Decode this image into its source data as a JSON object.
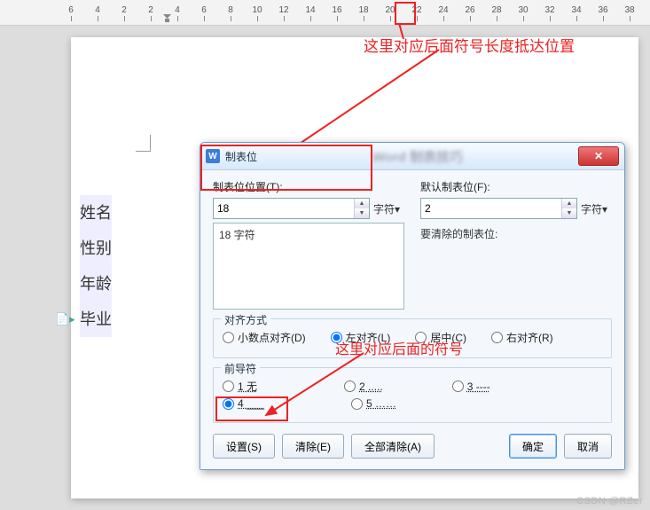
{
  "ruler": {
    "ticks": [
      -6,
      -4,
      -2,
      2,
      4,
      6,
      8,
      10,
      12,
      14,
      16,
      18,
      20,
      22,
      24,
      26,
      28,
      30,
      32,
      34,
      36,
      38
    ]
  },
  "page_text": {
    "l1": "姓名",
    "l2": "性别",
    "l3": "年龄",
    "l4": "毕业"
  },
  "annotation1": "这里对应后面符号长度抵达位置",
  "annotation2": "这里对应后面的符号",
  "dialog": {
    "title": "制表位",
    "blurred_title": "Word 制表技巧",
    "pos_label": "制表位位置(T):",
    "pos_value": "18",
    "unit": "字符▾",
    "listbox_entry": "18 字符",
    "default_label": "默认制表位(F):",
    "default_value": "2",
    "clear_note": "要清除的制表位:",
    "align_legend": "对齐方式",
    "align_decimal": "小数点对齐(D)",
    "align_left": "左对齐(L)",
    "align_center": "居中(C)",
    "align_right": "右对齐(R)",
    "leader_legend": "前导符",
    "leader1": "1 无",
    "leader2": "2 .....",
    "leader3": "3 ----",
    "leader4": "4 ___",
    "leader5": "5 ……",
    "btn_set": "设置(S)",
    "btn_clear": "清除(E)",
    "btn_clear_all": "全部清除(A)",
    "btn_ok": "确定",
    "btn_cancel": "取消"
  },
  "watermark": "CSDN @RZer"
}
